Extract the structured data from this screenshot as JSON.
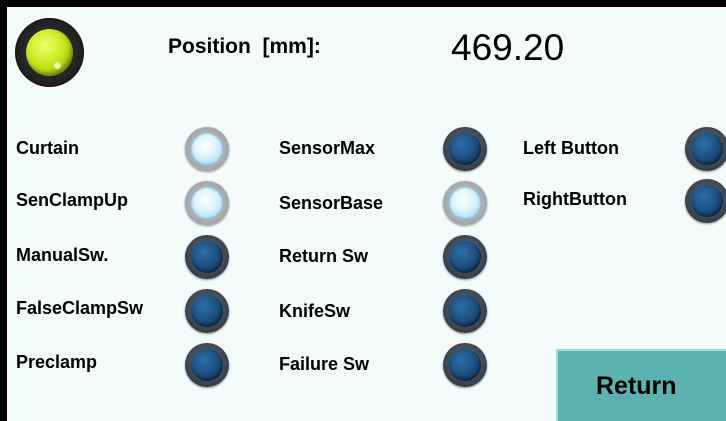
{
  "header": {
    "knob_icon": "yellow-knob-icon",
    "position_label": "Position  [mm]:",
    "position_value": "469.20"
  },
  "signals": {
    "col1": [
      {
        "label": "Curtain",
        "state": "on"
      },
      {
        "label": "SenClampUp",
        "state": "on"
      },
      {
        "label": "ManualSw.",
        "state": "off"
      },
      {
        "label": "FalseClampSw",
        "state": "off"
      },
      {
        "label": "Preclamp",
        "state": "off"
      }
    ],
    "col2": [
      {
        "label": "SensorMax",
        "state": "off"
      },
      {
        "label": "SensorBase",
        "state": "on"
      },
      {
        "label": "Return Sw",
        "state": "off"
      },
      {
        "label": "KnifeSw",
        "state": "off"
      },
      {
        "label": "Failure Sw",
        "state": "off"
      }
    ],
    "col3": [
      {
        "label": "Left Button",
        "state": "off"
      },
      {
        "label": "RightButton",
        "state": "off"
      }
    ]
  },
  "colors": {
    "lamp_on": "#bfe6fb",
    "lamp_off": "#1c4f80",
    "button": "#5cb2b0",
    "background": "#f4fbfb",
    "knob": "#c7e81f"
  },
  "actions": {
    "return_label": "Return"
  }
}
